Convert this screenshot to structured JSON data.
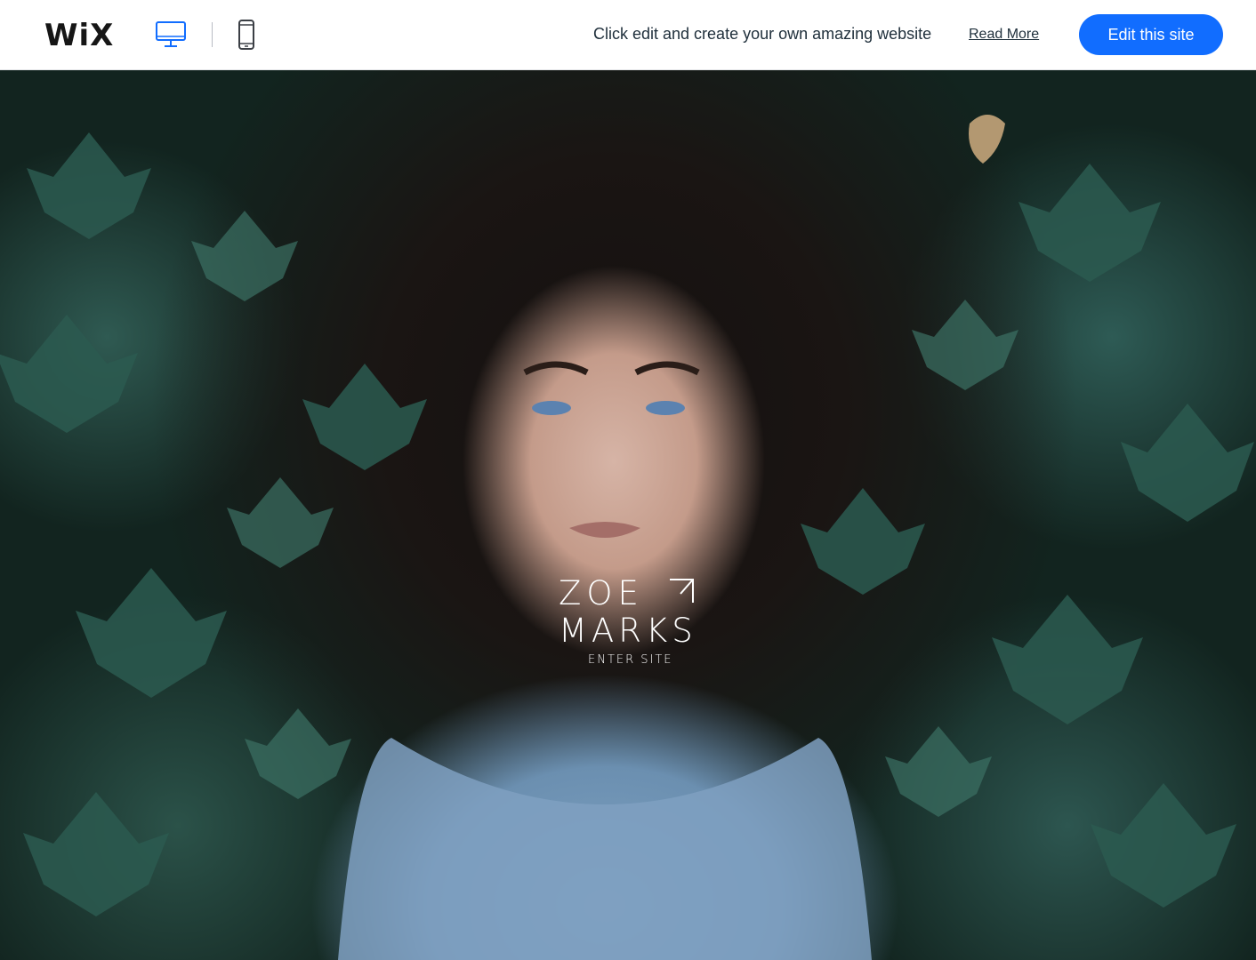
{
  "toolbar": {
    "logo": "WiX",
    "desktop_icon": "desktop-icon",
    "mobile_icon": "mobile-icon",
    "promo_text": "Click edit and create your own amazing website",
    "read_more": "Read More",
    "edit_button": "Edit this site",
    "accent_color": "#116dff"
  },
  "hero": {
    "title_line1": "ZOE",
    "title_line2": "MARKS",
    "enter_site": "ENTER SITE",
    "corner_icon": "corner-bracket-icon"
  }
}
